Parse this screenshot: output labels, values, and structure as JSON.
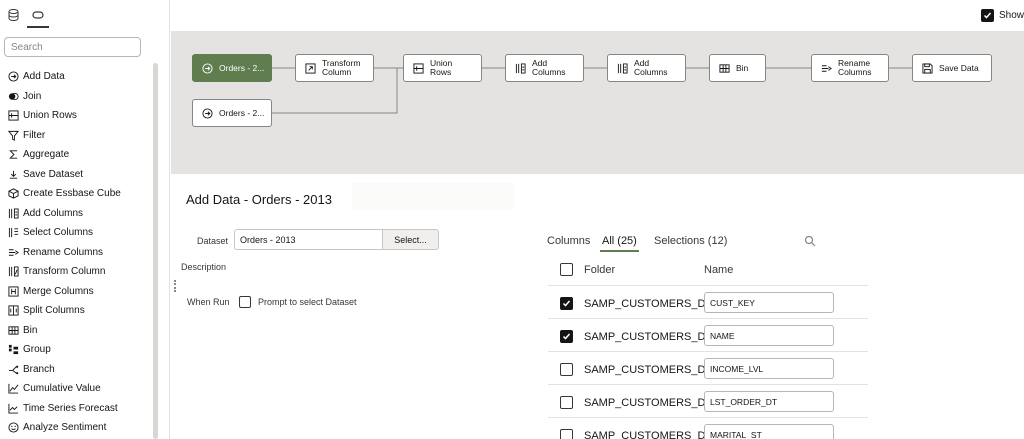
{
  "sidebar": {
    "search_placeholder": "Search",
    "items": [
      {
        "label": "Add Data",
        "icon": "add-data-icon"
      },
      {
        "label": "Join",
        "icon": "join-icon"
      },
      {
        "label": "Union Rows",
        "icon": "union-rows-icon"
      },
      {
        "label": "Filter",
        "icon": "filter-icon"
      },
      {
        "label": "Aggregate",
        "icon": "sigma-icon"
      },
      {
        "label": "Save Dataset",
        "icon": "save-dataset-icon"
      },
      {
        "label": "Create Essbase Cube",
        "icon": "cube-icon"
      },
      {
        "label": "Add Columns",
        "icon": "add-columns-icon"
      },
      {
        "label": "Select Columns",
        "icon": "select-columns-icon"
      },
      {
        "label": "Rename Columns",
        "icon": "rename-columns-icon"
      },
      {
        "label": "Transform Column",
        "icon": "transform-column-icon"
      },
      {
        "label": "Merge Columns",
        "icon": "merge-columns-icon"
      },
      {
        "label": "Split Columns",
        "icon": "split-columns-icon"
      },
      {
        "label": "Bin",
        "icon": "bin-icon"
      },
      {
        "label": "Group",
        "icon": "group-icon"
      },
      {
        "label": "Branch",
        "icon": "branch-icon"
      },
      {
        "label": "Cumulative Value",
        "icon": "cumulative-value-icon"
      },
      {
        "label": "Time Series Forecast",
        "icon": "time-series-icon"
      },
      {
        "label": "Analyze Sentiment",
        "icon": "sentiment-icon"
      }
    ]
  },
  "topbar": {
    "show_label": "Show",
    "show_checked": true
  },
  "flow": {
    "nodes": [
      {
        "id": "orders1",
        "line1": "Orders - 2...",
        "line2": "",
        "icon": "add-data-icon",
        "selected": true
      },
      {
        "id": "transform",
        "line1": "Transform",
        "line2": "Column",
        "icon": "transform-column-icon",
        "selected": false
      },
      {
        "id": "union",
        "line1": "Union",
        "line2": "Rows",
        "icon": "union-rows-icon",
        "selected": false
      },
      {
        "id": "addcols1",
        "line1": "Add",
        "line2": "Columns",
        "icon": "add-columns-icon",
        "selected": false
      },
      {
        "id": "addcols2",
        "line1": "Add",
        "line2": "Columns",
        "icon": "add-columns-icon",
        "selected": false
      },
      {
        "id": "bin",
        "line1": "Bin",
        "line2": "",
        "icon": "bin-icon",
        "selected": false
      },
      {
        "id": "rename",
        "line1": "Rename",
        "line2": "Columns",
        "icon": "rename-columns-icon",
        "selected": false
      },
      {
        "id": "save",
        "line1": "Save Data",
        "line2": "",
        "icon": "save-dataset-icon",
        "selected": false
      },
      {
        "id": "orders2",
        "line1": "Orders - 2...",
        "line2": "",
        "icon": "add-data-icon",
        "selected": false
      }
    ]
  },
  "panel": {
    "title": "Add Data - Orders - 2013",
    "dataset_label": "Dataset",
    "dataset_value": "Orders - 2013",
    "select_button": "Select...",
    "description_label": "Description",
    "when_run_label": "When Run",
    "prompt_label": "Prompt to select Dataset",
    "prompt_checked": false
  },
  "columns": {
    "label": "Columns",
    "tab_all": "All (25)",
    "tab_selections": "Selections (12)",
    "header_folder": "Folder",
    "header_name": "Name",
    "rows": [
      {
        "folder": "SAMP_CUSTOMERS_D",
        "name": "CUST_KEY",
        "checked": true
      },
      {
        "folder": "SAMP_CUSTOMERS_D",
        "name": "NAME",
        "checked": true
      },
      {
        "folder": "SAMP_CUSTOMERS_D",
        "name": "INCOME_LVL",
        "checked": false
      },
      {
        "folder": "SAMP_CUSTOMERS_D",
        "name": "LST_ORDER_DT",
        "checked": false
      },
      {
        "folder": "SAMP_CUSTOMERS_D",
        "name": "MARITAL_ST",
        "checked": false
      }
    ]
  }
}
